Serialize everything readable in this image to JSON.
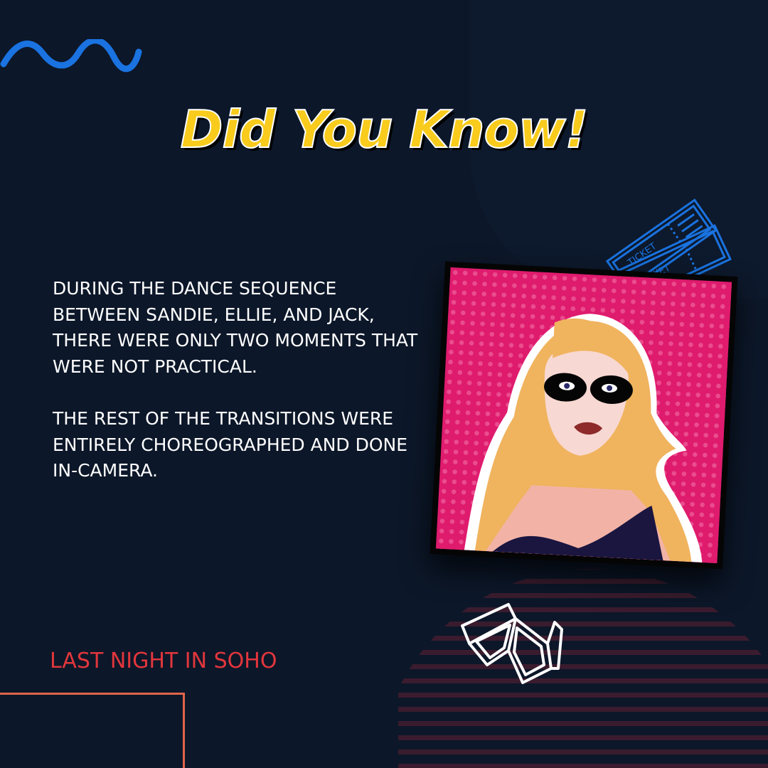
{
  "title": "Did You Know!",
  "body": {
    "paragraphs": [
      "During the dance sequence between Sandie, Ellie, and Jack, there were only two moments that were not practical.",
      "The rest of the transitions were entirely choreographed and done in-camera."
    ]
  },
  "footer": "LAST NIGHT IN SOHO",
  "tickets": {
    "label_1": "TICKET",
    "label_2": "TICKET"
  },
  "colors": {
    "background": "#0c1729",
    "title": "#f8cb1c",
    "accent_red": "#e2363c",
    "accent_blue": "#1a73e0",
    "pink": "#df1b6e",
    "orange": "#e0644a"
  },
  "icons": [
    "wave-squiggle",
    "ticket-icon",
    "3d-glasses-icon",
    "portrait-illustration"
  ]
}
